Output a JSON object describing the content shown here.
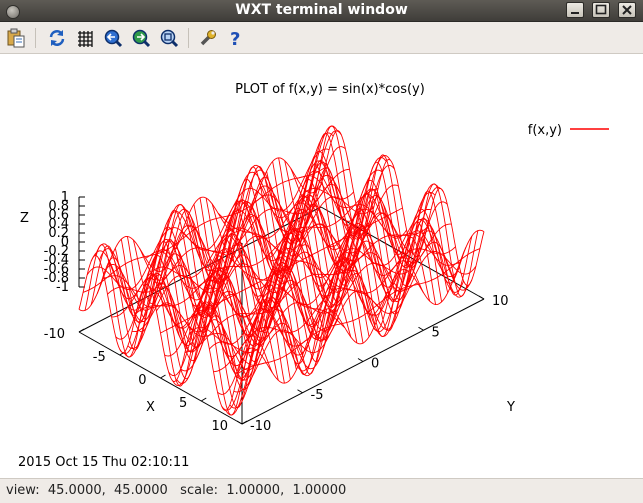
{
  "window": {
    "title": "WXT terminal window"
  },
  "toolbar": {
    "buttons": [
      {
        "name": "copy-to-clipboard",
        "icon": "clipboard-icon"
      },
      {
        "name": "replot",
        "icon": "replot-icon"
      },
      {
        "name": "toggle-grid",
        "icon": "grid-icon"
      },
      {
        "name": "previous-zoom",
        "icon": "zoom-previous-icon"
      },
      {
        "name": "next-zoom",
        "icon": "zoom-next-icon"
      },
      {
        "name": "autoscale",
        "icon": "zoom-fit-icon"
      },
      {
        "name": "configuration",
        "icon": "wrench-icon"
      },
      {
        "name": "help",
        "icon": "help-icon"
      }
    ]
  },
  "chart_data": {
    "type": "surface",
    "function": "sin(x)*cos(y)",
    "title": "PLOT of f(x,y) = sin(x)*cos(y)",
    "legend": {
      "label": "f(x,y)",
      "position": "top-right",
      "color": "#ff0000"
    },
    "xlabel": "X",
    "ylabel": "Y",
    "zlabel": "Z",
    "xlim": [
      -10,
      10
    ],
    "ylim": [
      -10,
      10
    ],
    "zlim": [
      -1,
      1
    ],
    "x_ticks": [
      "-10",
      "-5",
      "0",
      "5",
      "10"
    ],
    "y_ticks": [
      "-10",
      "-5",
      "0",
      "5",
      "10"
    ],
    "z_ticks": [
      "1",
      "0.8",
      "0.6",
      "0.4",
      "0.2",
      "0",
      "-0.2",
      "-0.4",
      "-0.6",
      "-0.8",
      "-1"
    ],
    "view": [
      45,
      45
    ],
    "grid": false,
    "line_color": "#ff0000"
  },
  "timestamp": "2015 Oct 15 Thu 02:10:11",
  "status": {
    "text": "view:  45.0000,  45.0000   scale:  1.00000,  1.00000"
  },
  "colors": {
    "titlebar": "#4a4844",
    "toolbar": "#efebe7",
    "surface": "#ff0000"
  }
}
